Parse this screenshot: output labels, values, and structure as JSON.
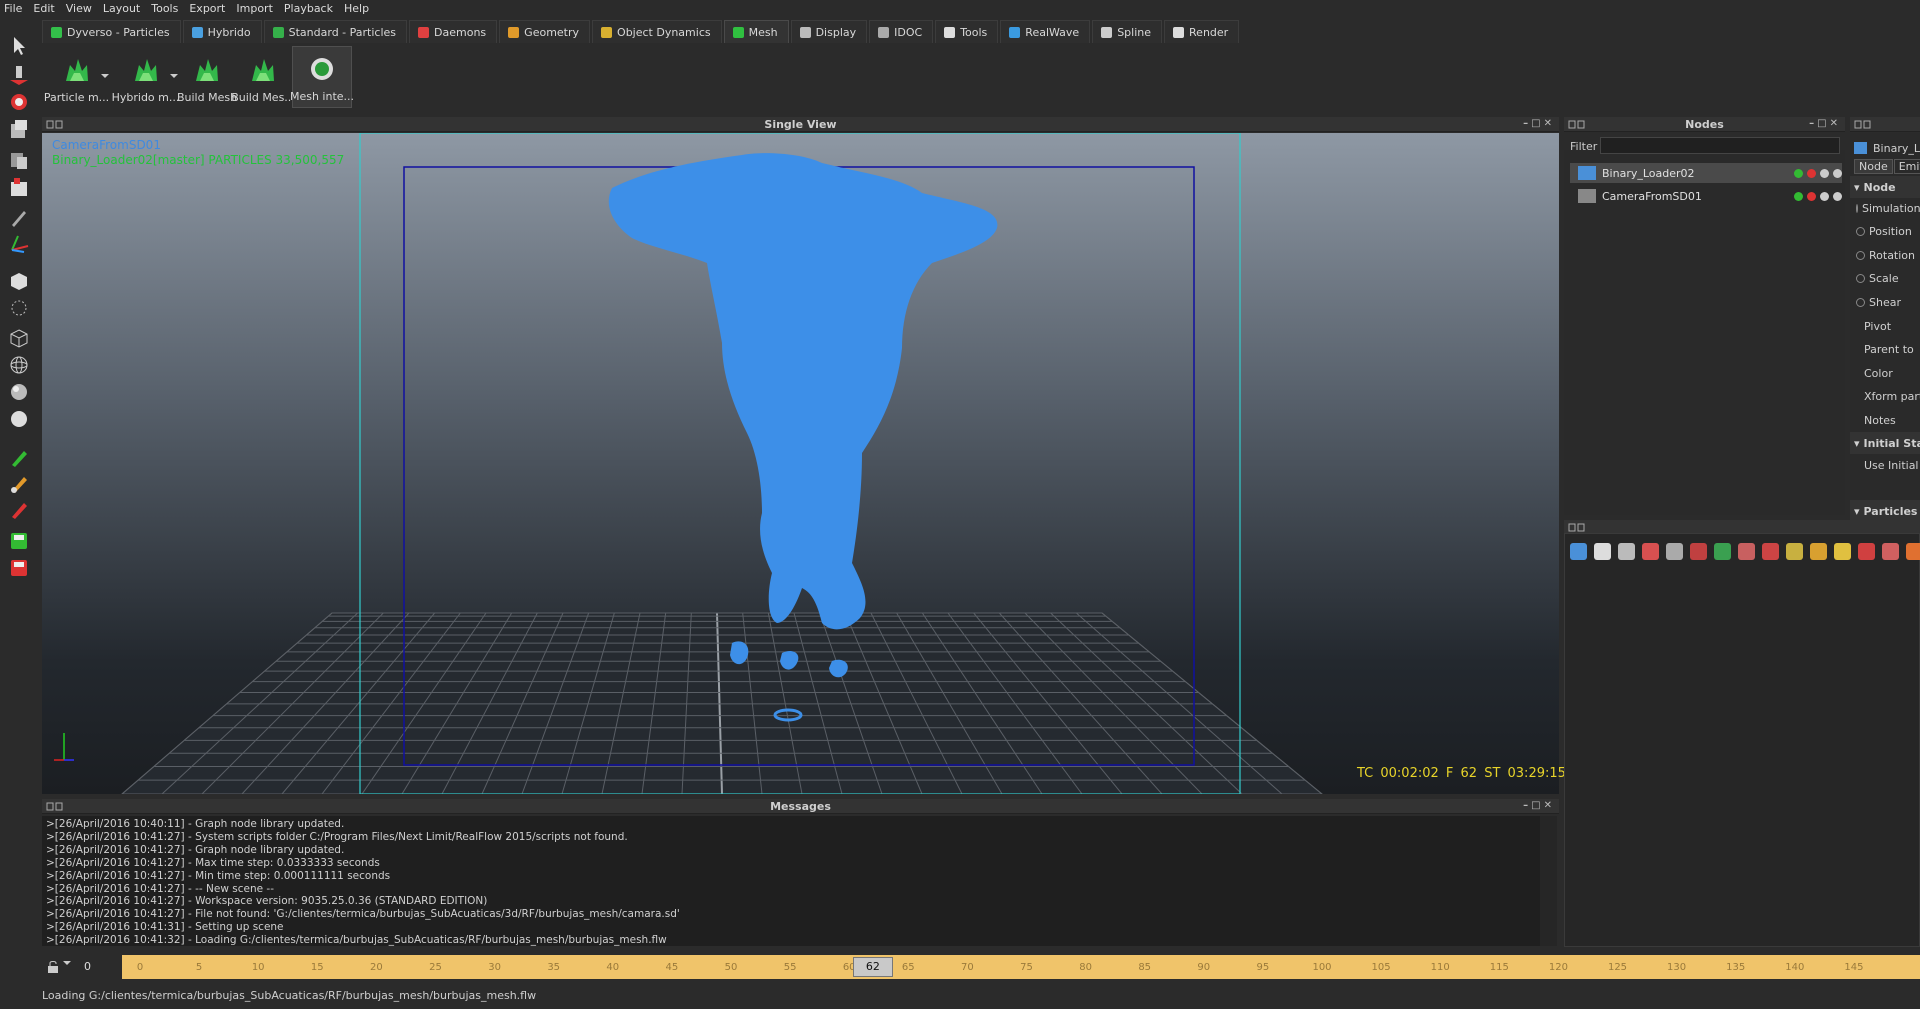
{
  "menu": [
    "File",
    "Edit",
    "View",
    "Layout",
    "Tools",
    "Export",
    "Import",
    "Playback",
    "Help"
  ],
  "tabs": [
    {
      "label": "Dyverso - Particles",
      "icon": "particles-icon",
      "color": "#33c04a"
    },
    {
      "label": "Hybrido",
      "icon": "hybrido-icon",
      "color": "#4aa0e0"
    },
    {
      "label": "Standard - Particles",
      "icon": "standard-particles-icon",
      "color": "#35b04a"
    },
    {
      "label": "Daemons",
      "icon": "daemons-icon",
      "color": "#e04040"
    },
    {
      "label": "Geometry",
      "icon": "geometry-icon",
      "color": "#e09a2a"
    },
    {
      "label": "Object Dynamics",
      "icon": "object-dynamics-icon",
      "color": "#d8b030"
    },
    {
      "label": "Mesh",
      "icon": "mesh-icon",
      "color": "#30c040"
    },
    {
      "label": "Display",
      "icon": "display-icon",
      "color": "#bbbbbb"
    },
    {
      "label": "IDOC",
      "icon": "idoc-icon",
      "color": "#aaaaaa"
    },
    {
      "label": "Tools",
      "icon": "tools-icon",
      "color": "#dddddd"
    },
    {
      "label": "RealWave",
      "icon": "realwave-icon",
      "color": "#3a9ae0"
    },
    {
      "label": "Spline",
      "icon": "spline-icon",
      "color": "#cccccc"
    },
    {
      "label": "Render",
      "icon": "render-icon",
      "color": "#dddddd"
    }
  ],
  "active_tab": "Mesh",
  "shelf": [
    {
      "label": "Particle m...",
      "dropdown": true
    },
    {
      "label": "Hybrido m...",
      "dropdown": true
    },
    {
      "label": "Build Mesh",
      "dropdown": false
    },
    {
      "label": "Build Mes...",
      "dropdown": false
    },
    {
      "label": "Mesh inte...",
      "dropdown": false
    }
  ],
  "viewport": {
    "title": "Single View",
    "camera_label": "CameraFromSD01",
    "particles_label": "Binary_Loader02[master] PARTICLES 33,500,557",
    "timecode": "TC 00:02:02   F 62   ST 03:29:15"
  },
  "messages": {
    "title": "Messages",
    "lines": [
      ">[26/April/2016 10:40:11] - Graph node library updated.",
      ">[26/April/2016 10:41:27] - System scripts folder C:/Program Files/Next Limit/RealFlow 2015/scripts not found.",
      ">[26/April/2016 10:41:27] - Graph node library updated.",
      ">[26/April/2016 10:41:27] - Max time step: 0.0333333 seconds",
      ">[26/April/2016 10:41:27] - Min time step: 0.000111111 seconds",
      ">[26/April/2016 10:41:27] - -- New scene --",
      ">[26/April/2016 10:41:27] - Workspace version: 9035.25.0.36 (STANDARD EDITION)",
      ">[26/April/2016 10:41:27] - File not found: 'G:/clientes/termica/burbujas_SubAcuaticas/3d/RF/burbujas_mesh/camara.sd'",
      ">[26/April/2016 10:41:31] - Setting up scene",
      ">[26/April/2016 10:41:32] - Loading G:/clientes/termica/burbujas_SubAcuaticas/RF/burbujas_mesh/burbujas_mesh.flw"
    ]
  },
  "timeline": {
    "start_frame": "0",
    "current_frame": "62",
    "ticks": [
      "0",
      "5",
      "10",
      "15",
      "20",
      "25",
      "30",
      "35",
      "40",
      "45",
      "50",
      "55",
      "60",
      "65",
      "70",
      "75",
      "80",
      "85",
      "90",
      "95",
      "100",
      "105",
      "110",
      "115",
      "120",
      "125",
      "130",
      "135",
      "140",
      "145"
    ]
  },
  "status_text": "Loading G:/clientes/termica/burbujas_SubAcuaticas/RF/burbujas_mesh/burbujas_mesh.flw",
  "nodes": {
    "title": "Nodes",
    "filter_label": "Filter",
    "filter_value": "",
    "items": [
      {
        "name": "Binary_Loader02",
        "selected": true
      },
      {
        "name": "CameraFromSD01",
        "selected": false
      }
    ]
  },
  "properties": {
    "header_name": "Binary_L",
    "tabs": [
      "Node",
      "Emit"
    ],
    "section_node": "Node",
    "radio_rows": [
      "Simulation",
      "Position",
      "Rotation",
      "Scale",
      "Shear"
    ],
    "plain_rows": [
      "Pivot",
      "Parent to",
      "Color",
      "Xform partic",
      "Notes"
    ],
    "section_initial": "Initial Stat",
    "initial_row": "Use Initial S",
    "section_particles": "Particles"
  },
  "colors": {
    "accent_green": "#24c23b",
    "fluid_blue": "#3d8fe8",
    "timeline": "#f0c46a",
    "timecode": "#e8d42a"
  }
}
